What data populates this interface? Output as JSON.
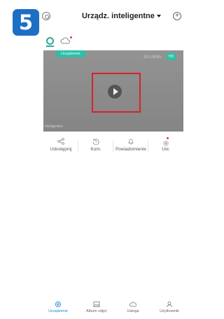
{
  "step_badge": "5",
  "header": {
    "title": "Urządz. inteligentne",
    "left_icon": "scan-icon",
    "right_icon": "add-circle-icon"
  },
  "device": {
    "status_pill": "Urządzenie",
    "stats_text": "SD 0.0KB/s",
    "quality_label": "HD",
    "watermark": "Inteligentne"
  },
  "actions": [
    {
      "label": "Udostępnij",
      "icon": "share-icon"
    },
    {
      "label": "Kom.",
      "icon": "history-icon"
    },
    {
      "label": "Powiadomienie",
      "icon": "bell-icon"
    },
    {
      "label": "Ust.",
      "icon": "settings-icon"
    }
  ],
  "tabs": [
    {
      "label": "Urządzenie",
      "icon": "home-icon",
      "active": true
    },
    {
      "label": "Album zdjęć",
      "icon": "album-icon",
      "active": false
    },
    {
      "label": "Usługa",
      "icon": "cloud-service-icon",
      "active": false
    },
    {
      "label": "Użytkownik",
      "icon": "user-icon",
      "active": false
    }
  ],
  "colors": {
    "accent_teal": "#2dbfa6",
    "highlight_red": "#d9212a",
    "tab_active_blue": "#1e8ad6",
    "step_badge_blue": "#1e6fc4"
  }
}
